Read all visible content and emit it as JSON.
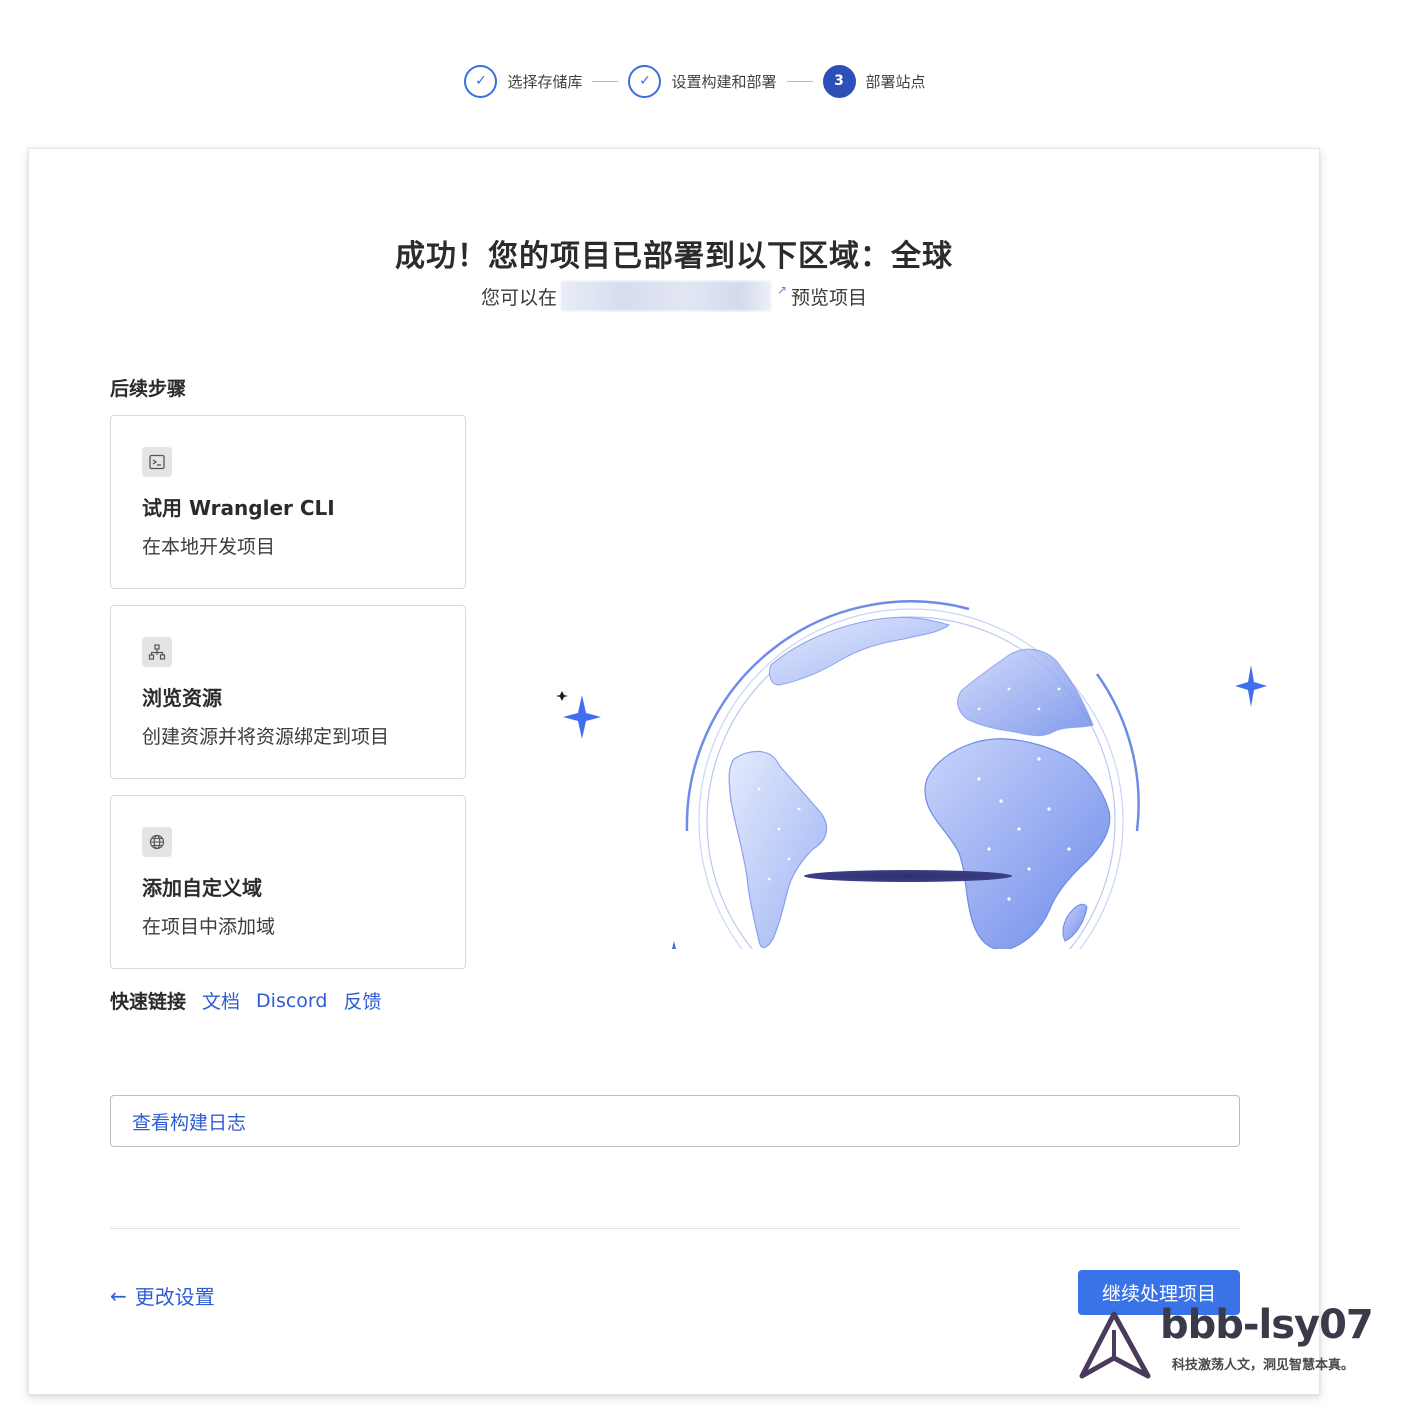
{
  "stepper": {
    "steps": [
      {
        "label": "选择存储库",
        "state": "done",
        "marker": "✓"
      },
      {
        "label": "设置构建和部署",
        "state": "done",
        "marker": "✓"
      },
      {
        "label": "部署站点",
        "state": "active",
        "marker": "3"
      }
    ]
  },
  "main": {
    "headline": "成功！您的项目已部署到以下区域：全球",
    "preview_prefix": "您可以在",
    "preview_suffix": "预览项目"
  },
  "next_steps": {
    "title": "后续步骤",
    "tiles": [
      {
        "title": "试用 Wrangler CLI",
        "description": "在本地开发项目",
        "icon": "terminal-icon"
      },
      {
        "title": "浏览资源",
        "description": "创建资源并将资源绑定到项目",
        "icon": "sitemap-icon"
      },
      {
        "title": "添加自定义域",
        "description": "在项目中添加域",
        "icon": "globe-icon"
      }
    ]
  },
  "quick_links": {
    "label": "快速链接",
    "links": [
      "文档",
      "Discord",
      "反馈"
    ]
  },
  "build_log_label": "查看构建日志",
  "footer": {
    "back_label": "更改设置",
    "continue_label": "继续处理项目"
  },
  "watermark": {
    "title": "bbb-lsy07",
    "subtitle": "科技激荡人文，洞见智慧本真。"
  },
  "colors": {
    "accent": "#3a73e8",
    "link": "#2f5dd3",
    "step_active": "#2c4fb8",
    "globe": "#7d97ee"
  }
}
